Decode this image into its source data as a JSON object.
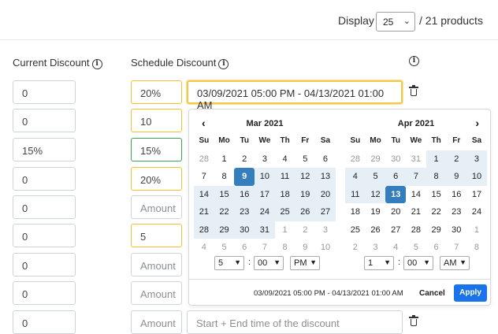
{
  "toolbar": {
    "display_label": "Display",
    "per_page": "25",
    "products_count": "/ 21 products"
  },
  "headers": {
    "current_discount": "Current Discount",
    "schedule_discount": "Schedule Discount"
  },
  "rows": [
    {
      "current": "0",
      "schedule": "20%",
      "date": "03/09/2021 05:00 PM - 04/13/2021 01:00 AM"
    },
    {
      "current": "0",
      "schedule": "10"
    },
    {
      "current": "15%",
      "schedule": "15%"
    },
    {
      "current": "0",
      "schedule": "20%"
    },
    {
      "current": "0",
      "schedule_placeholder": "Amount"
    },
    {
      "current": "0",
      "schedule": "5"
    },
    {
      "current": "0",
      "schedule_placeholder": "Amount"
    },
    {
      "current": "0",
      "schedule_placeholder": "Amount"
    },
    {
      "current": "0",
      "schedule_placeholder": "Amount",
      "date_placeholder": "Start + End time of the discount"
    }
  ],
  "picker": {
    "left_month": "Mar 2021",
    "right_month": "Apr 2021",
    "weekdays": [
      "Su",
      "Mo",
      "Tu",
      "We",
      "Th",
      "Fr",
      "Sa"
    ],
    "left_days": [
      [
        "28",
        "1",
        "2",
        "3",
        "4",
        "5",
        "6"
      ],
      [
        "7",
        "8",
        "9",
        "10",
        "11",
        "12",
        "13"
      ],
      [
        "14",
        "15",
        "16",
        "17",
        "18",
        "19",
        "20"
      ],
      [
        "21",
        "22",
        "23",
        "24",
        "25",
        "26",
        "27"
      ],
      [
        "28",
        "29",
        "30",
        "31",
        "1",
        "2",
        "3"
      ],
      [
        "4",
        "5",
        "6",
        "7",
        "8",
        "9",
        "10"
      ]
    ],
    "right_days": [
      [
        "28",
        "29",
        "30",
        "31",
        "1",
        "2",
        "3"
      ],
      [
        "4",
        "5",
        "6",
        "7",
        "8",
        "9",
        "10"
      ],
      [
        "11",
        "12",
        "13",
        "14",
        "15",
        "16",
        "17"
      ],
      [
        "18",
        "19",
        "20",
        "21",
        "22",
        "23",
        "24"
      ],
      [
        "25",
        "26",
        "27",
        "28",
        "29",
        "30",
        "1"
      ],
      [
        "2",
        "3",
        "4",
        "5",
        "6",
        "7",
        "8"
      ]
    ],
    "start_time": {
      "hour": "5",
      "minute": "00",
      "ampm": "PM"
    },
    "end_time": {
      "hour": "1",
      "minute": "00",
      "ampm": "AM"
    },
    "range_text": "03/09/2021 05:00 PM - 04/13/2021 01:00 AM",
    "cancel_label": "Cancel",
    "apply_label": "Apply",
    "selected_color": "#357ebd",
    "range_color": "#e6eff5"
  },
  "colors": {
    "apply_button": "#1a73e8",
    "warning_border": "#f3c033",
    "success_border": "#3aa655"
  }
}
